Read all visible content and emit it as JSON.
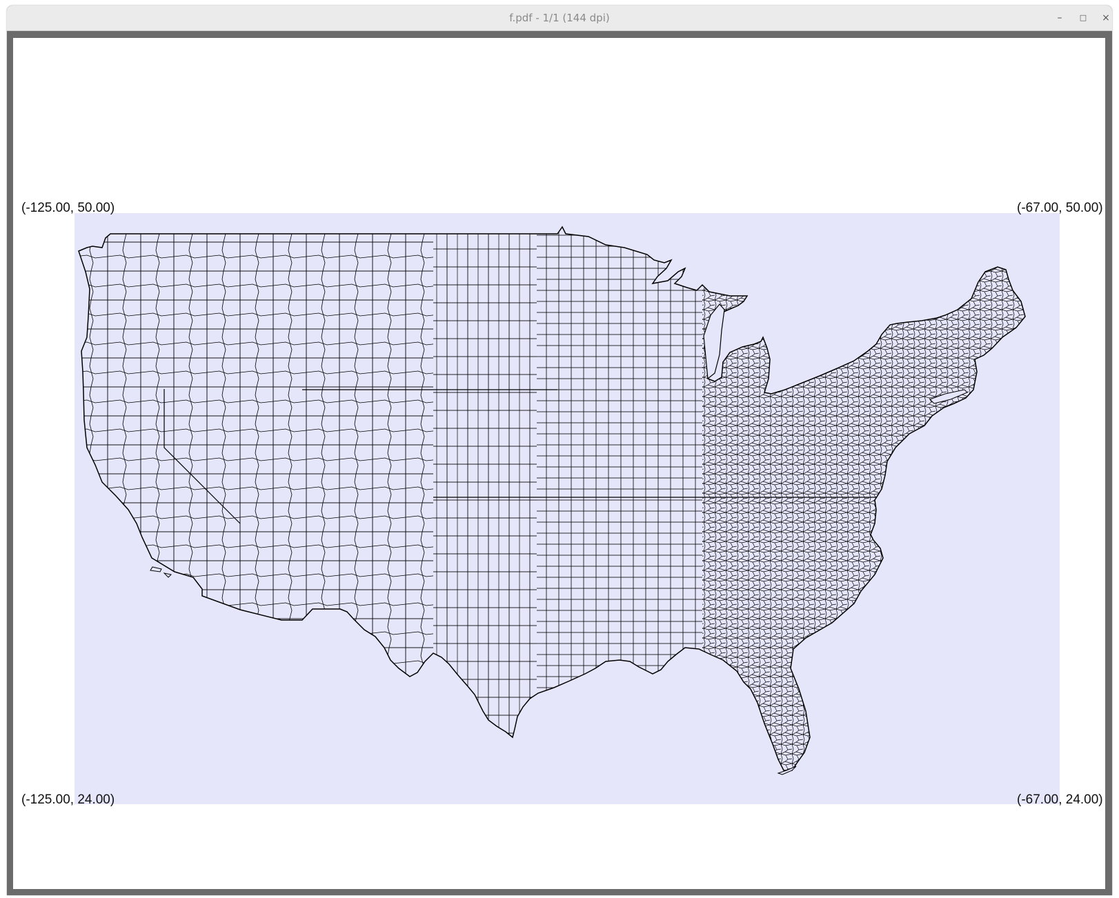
{
  "window": {
    "title": "f.pdf - 1/1 (144 dpi)",
    "controls": {
      "minimize": "–",
      "maximize": "□",
      "close": "×"
    }
  },
  "map": {
    "subject": "US county boundaries (contiguous states)",
    "fill_color": "#e6e6fa",
    "line_color": "#000000",
    "corners": {
      "top_left": "(-125.00, 50.00)",
      "top_right": "(-67.00, 50.00)",
      "bottom_left": "(-125.00, 24.00)",
      "bottom_right": "(-67.00, 24.00)"
    }
  }
}
